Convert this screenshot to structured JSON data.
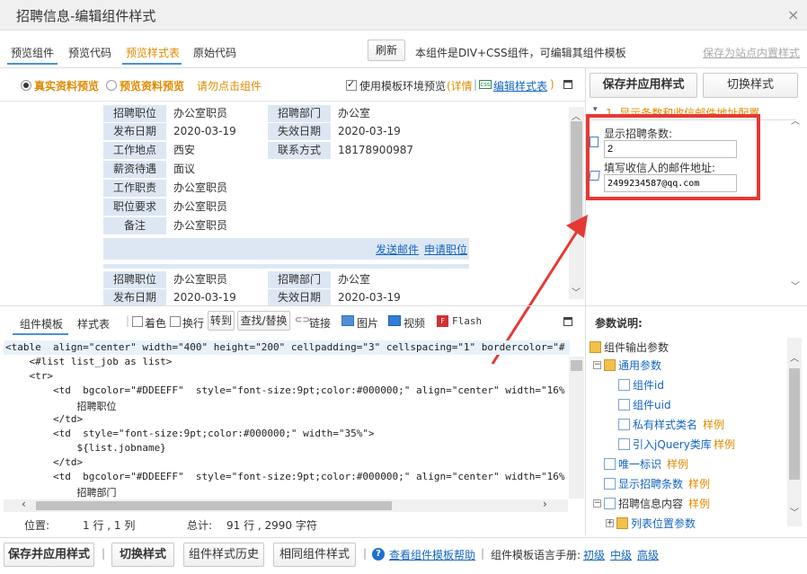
{
  "window": {
    "title": "招聘信息-编辑组件样式",
    "close": "×"
  },
  "tabs": [
    "预览组件",
    "预览代码",
    "预览样式表",
    "原始代码"
  ],
  "refresh_label": "刷新",
  "notice": "本组件是DIV+CSS组件，可编辑其组件模板",
  "save_site": "保存为站点内置样式",
  "preview_options": {
    "real": "真实资料预览",
    "sample": "预览资料预览",
    "hint": "请勿点击组件",
    "use_env": "使用模板环境预览",
    "detail": "(详情",
    "separator": "|",
    "edit_css": "编辑样式表",
    "close_paren": ")"
  },
  "right_buttons": {
    "save_apply": "保存并应用样式",
    "switch": "切换样式"
  },
  "config": {
    "section_title": "1. 显示条数和收信邮件地址配置",
    "count_label": "显示招聘条数:",
    "count_value": "2",
    "email_label": "填写收信人的邮件地址:",
    "email_value": "2499234587@qq.com"
  },
  "job1": {
    "rows": [
      {
        "l1": "招聘职位",
        "v1": "办公室职员",
        "l2": "招聘部门",
        "v2": "办公室"
      },
      {
        "l1": "发布日期",
        "v1": "2020-03-19",
        "l2": "失效日期",
        "v2": "2020-03-19"
      },
      {
        "l1": "工作地点",
        "v1": "西安",
        "l2": "联系方式",
        "v2": "18178900987"
      },
      {
        "l1": "薪资待遇",
        "v1": "面议"
      },
      {
        "l1": "工作职责",
        "v1": "办公室职员"
      },
      {
        "l1": "职位要求",
        "v1": "办公室职员"
      },
      {
        "l1": "备注",
        "v1": "办公室职员"
      }
    ],
    "send_mail": "发送邮件",
    "apply": "申请职位"
  },
  "job2": {
    "rows": [
      {
        "l1": "招聘职位",
        "v1": "办公室职员",
        "l2": "招聘部门",
        "v2": "办公室"
      },
      {
        "l1": "发布日期",
        "v1": "2020-03-19",
        "l2": "失效日期",
        "v2": "2020-03-19"
      }
    ]
  },
  "editor_tabs": {
    "template": "组件模板",
    "css": "样式表"
  },
  "editor_tools": {
    "color": "着色",
    "wrap": "换行",
    "goto": "转到",
    "find": "查找/替换",
    "link": "链接",
    "image": "图片",
    "video": "视频",
    "flash": "Flash"
  },
  "code_lines": [
    "<table  align=\"center\" width=\"400\" height=\"200\" cellpadding=\"3\" cellspacing=\"1\" bordercolor=\"#",
    "    <#list list_job as list>",
    "    <tr>",
    "        <td  bgcolor=\"#DDEEFF\"  style=\"font-size:9pt;color:#000000;\" align=\"center\" width=\"16%",
    "            招聘职位",
    "        </td>",
    "        <td  style=\"font-size:9pt;color:#000000;\" width=\"35%\">",
    "            ${list.jobname}",
    "        </td>",
    "        <td  bgcolor=\"#DDEEFF\"  style=\"font-size:9pt;color:#000000;\" align=\"center\" width=\"16%",
    "            招聘部门"
  ],
  "status": {
    "pos_label": "位置:",
    "pos_value": "1 行 , 1 列",
    "total_label": "总计:",
    "total_value": "91 行 , 2990 字符"
  },
  "params": {
    "title": "参数说明:",
    "tree": [
      {
        "label": "组件输出参数",
        "tag": ""
      },
      {
        "label": "通用参数",
        "tag": ""
      },
      {
        "label": "组件id",
        "tag": ""
      },
      {
        "label": "组件uid",
        "tag": ""
      },
      {
        "label": "私有样式类名",
        "tag": "样例"
      },
      {
        "label": "引入jQuery类库",
        "tag": "样例"
      },
      {
        "label": "唯一标识",
        "tag": "样例"
      },
      {
        "label": "显示招聘条数",
        "tag": "样例"
      },
      {
        "label": "招聘信息内容",
        "tag": "样例"
      },
      {
        "label": "列表位置参数",
        "tag": ""
      }
    ]
  },
  "bottom": {
    "save_apply": "保存并应用样式",
    "switch": "切换样式",
    "history": "组件样式历史",
    "same": "相同组件样式",
    "help": "查看组件模板帮助",
    "manual": "组件模板语言手册:",
    "primary": "初级",
    "middle": "中级",
    "advanced": "高级"
  }
}
